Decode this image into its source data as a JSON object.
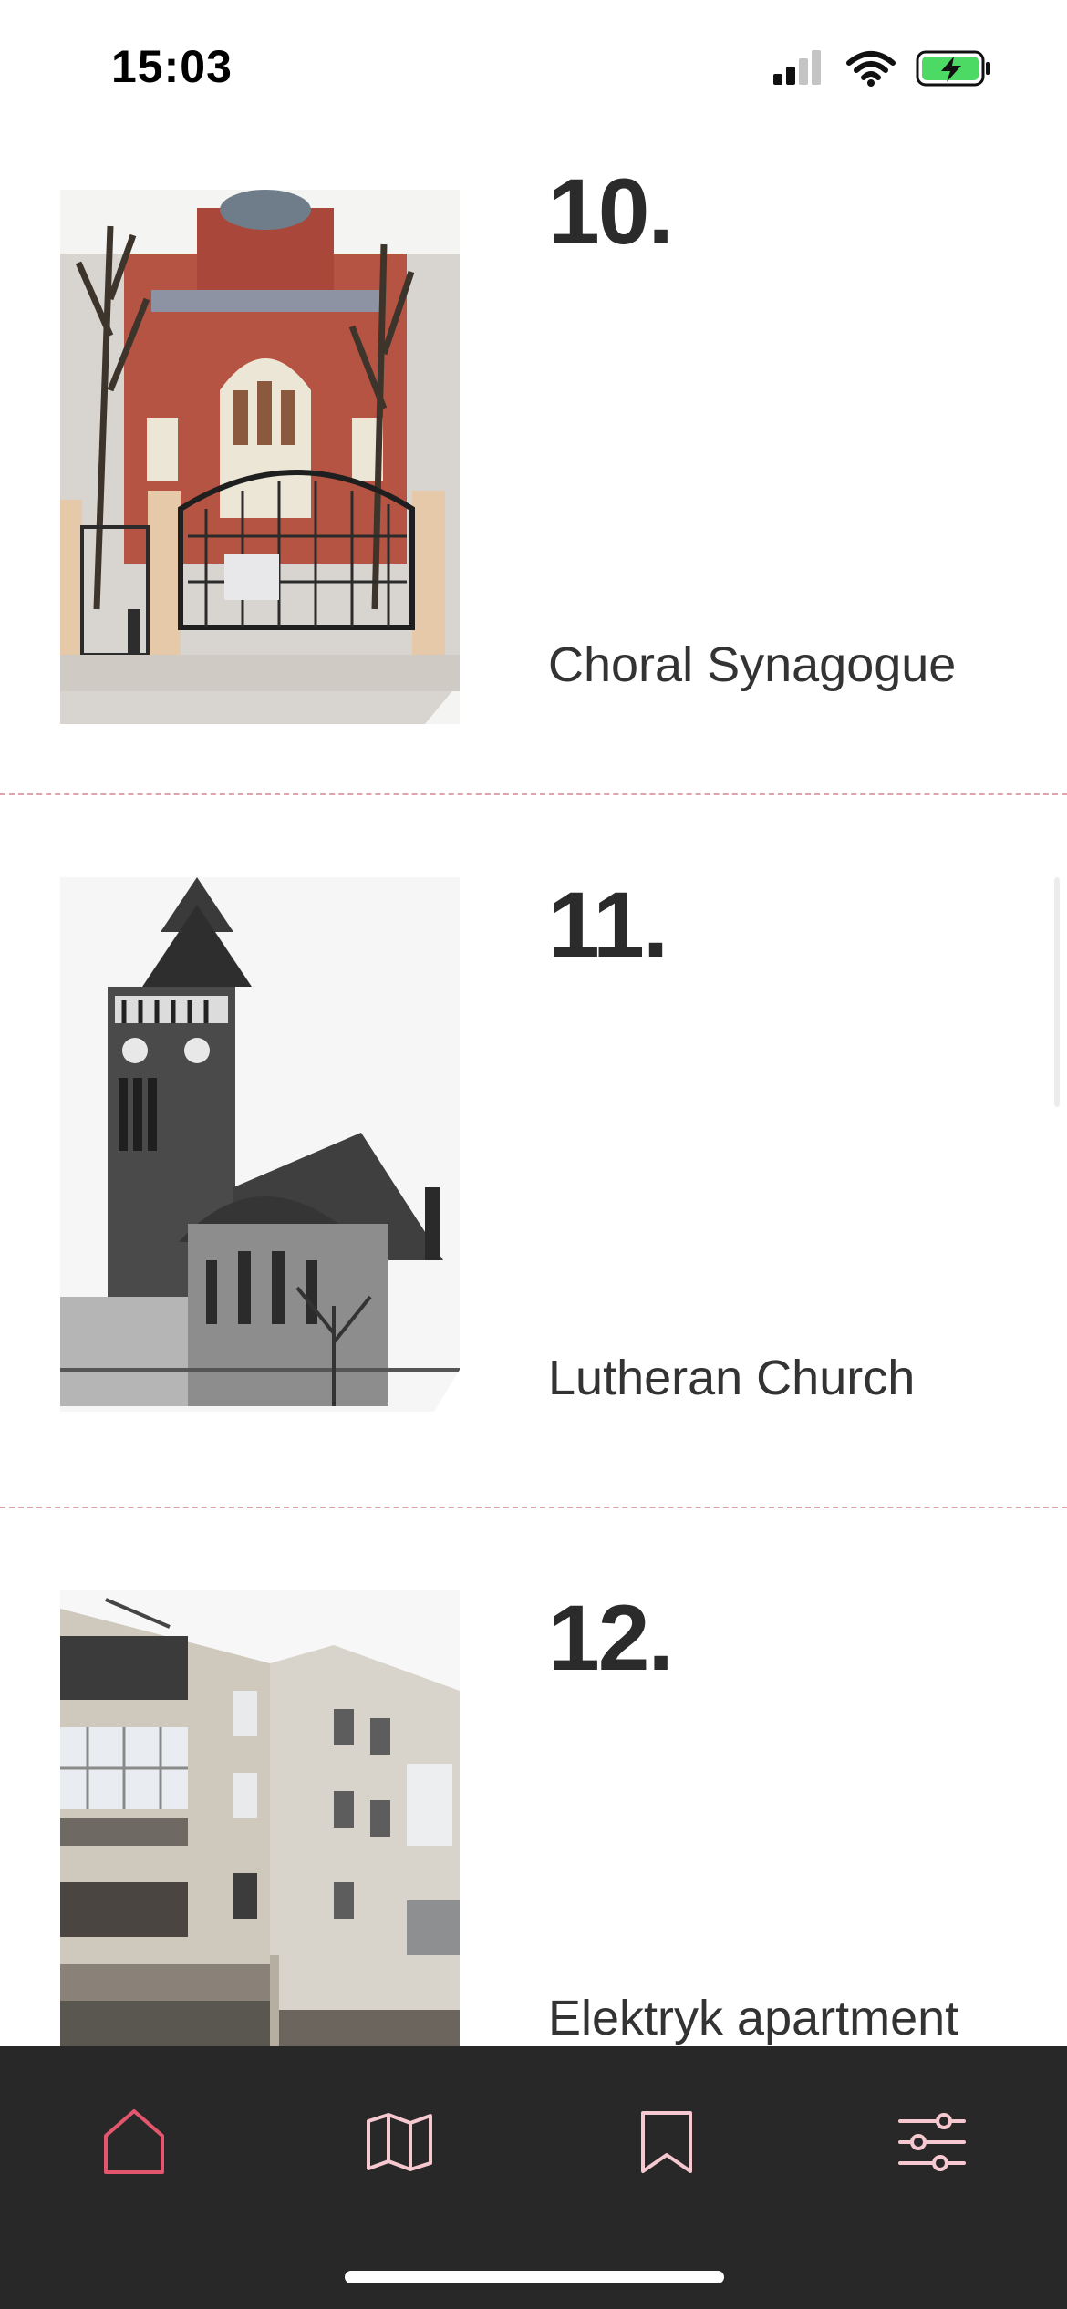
{
  "status_bar": {
    "time": "15:03",
    "icons": [
      "cellular-signal-icon",
      "wifi-icon",
      "battery-charging-icon"
    ],
    "battery_color": "#4cd964"
  },
  "entries": [
    {
      "number": "10.",
      "title": "Choral Synagogue",
      "image": "choral-synagogue-photo"
    },
    {
      "number": "11.",
      "title": "Lutheran Church",
      "image": "lutheran-church-photo"
    },
    {
      "number": "12.",
      "title": "Elektryk apartment",
      "image": "elektryk-apartment-photo"
    }
  ],
  "tab_bar": {
    "tabs": [
      {
        "name": "home",
        "icon": "home-icon",
        "active": true
      },
      {
        "name": "map",
        "icon": "map-icon",
        "active": false
      },
      {
        "name": "bookmarks",
        "icon": "bookmark-icon",
        "active": false
      },
      {
        "name": "settings",
        "icon": "sliders-icon",
        "active": false
      }
    ],
    "active_color": "#e4566e",
    "inactive_color": "#f6c9d1",
    "background": "#282828"
  }
}
